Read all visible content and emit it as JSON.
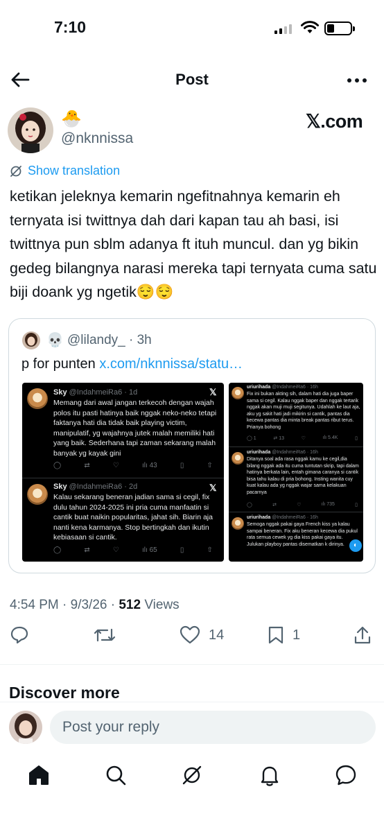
{
  "status": {
    "time": "7:10"
  },
  "nav": {
    "title": "Post"
  },
  "author": {
    "emoji": "🐣",
    "handle": "@nknnissa",
    "watermark": "𝕏.com"
  },
  "translation": {
    "label": "Show translation"
  },
  "tweet": {
    "text": "ketikan jeleknya kemarin ngefitnahnya kemarin eh ternyata isi twittnya dah dari kapan tau ah basi, isi twittnya pun sblm adanya ft ituh muncul. dan yg bikin gedeg bilangnya narasi mereka tapi ternyata cuma satu biji doank yg ngetik😌😌"
  },
  "quote": {
    "emoji": "💀",
    "handle": "@lilandy_",
    "time": "· 3h",
    "text": "p for punten ",
    "link": "x.com/nknnissa/statu…",
    "left_image": [
      {
        "name": "Sky",
        "handle": "@IndahmeiRa6 · 1d",
        "body": "Memang dari awal jangan terkecoh dengan wajah polos itu pasti hatinya baik nggak neko-neko  tetapi faktanya hati dia tidak baik playing victim, manipulatif, yg wajahnya jutek malah memiliki hati yang baik. Sederhana tapi zaman sekarang malah banyak yg kayak gini",
        "views": "43"
      },
      {
        "name": "Sky",
        "handle": "@IndahmeiRa6 · 2d",
        "body": "Kalau sekarang beneran jadian sama si cegil, fix dulu tahun 2024-2025 ini pria cuma manfaatin si cantik buat naikin popularitas, jahat sih. Biarin aja nanti kena karmanya. Stop bertingkah dan ikutin kebiasaan si cantik.",
        "views": "65"
      }
    ],
    "right_image": [
      {
        "name": "uriurihada",
        "handle": "@IndahmeiRa6 · 16h",
        "body": "Fix ini bukan akting sih, dalam hati dia juga baper sama si cegil. Kalau nggak baper dan nggak tertarik nggak akan muji muji segitunya. Udahlah ke laut aja, aku yg sakit hati jadi mikirin si cantik, pantas dia kecewa pantas dia minta break pantas ribut terus. Prianya bohong",
        "replies": "1",
        "reposts": "13",
        "views": "5.4K"
      },
      {
        "name": "uriurihada",
        "handle": "@IndahmeiRa6 · 16h",
        "body": "Ditanya soal ada rasa nggak kamu ke cegil,dia bilang nggak ada itu cuma tuntutan skrip, tapi dalam hatinya berkata lain, entah gimana caranya si cantik bisa tahu kalau di pria bohong. Insting wanita cuy kuat kalau ada yg nggak wajar sama kelakuan pacarnya",
        "views": "735"
      },
      {
        "name": "uriurihada",
        "handle": "@IndahmeiRa6 · 16h",
        "body": "Semoga nggak pakai gaya French kiss ya kalau sampai beneran. Fix aku beneran kecewa dia pukul rata semua cewek yg dia kiss pakai gaya itu. Julukan playboy pantas disematkan k dirinya."
      }
    ]
  },
  "meta": {
    "time": "4:54 PM · 9/3/26 · ",
    "views_count": "512",
    "views_label": " Views"
  },
  "actions": {
    "likes": "14",
    "bookmarks": "1"
  },
  "discover": {
    "title": "Discover more"
  },
  "reply": {
    "placeholder": "Post your reply"
  },
  "colors": {
    "accent": "#1d9bf0",
    "text": "#0f1419",
    "muted": "#536471"
  }
}
